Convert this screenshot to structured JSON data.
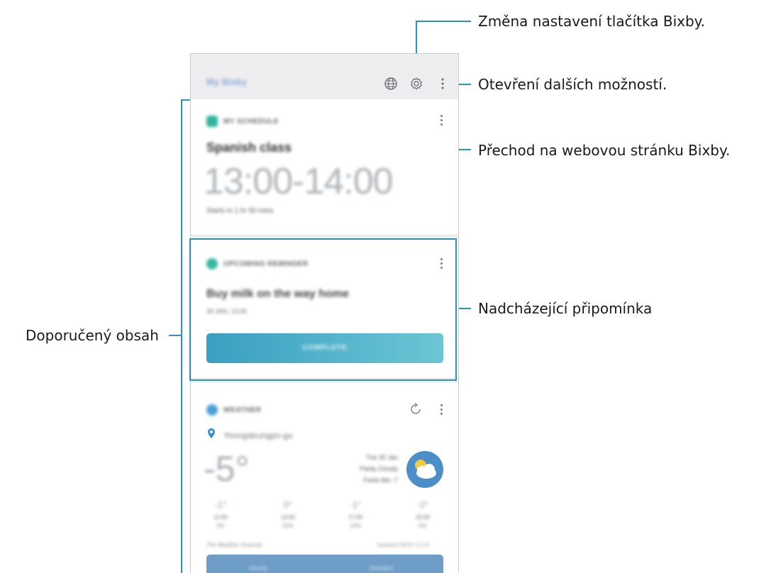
{
  "callouts": {
    "bixby_button_settings": "Změna nastavení tlačítka Bixby.",
    "more_options": "Otevření dalších možností.",
    "bixby_website": "Přechod na webovou stránku Bixby.",
    "upcoming_reminder": "Nadcházející připomínka",
    "recommended_content": "Doporučený obsah"
  },
  "header": {
    "brand": "My Bixby",
    "icons": [
      "globe-icon",
      "gear-icon",
      "more-options-icon"
    ]
  },
  "schedule_card": {
    "label": "MY SCHEDULE",
    "title": "Spanish class",
    "time": "13:00-14:00",
    "subtitle": "Starts in 1 hr 50 mins"
  },
  "reminder_card": {
    "label": "UPCOMING REMINDER",
    "title": "Buy milk on the way home",
    "date": "30 JAN, 13:30",
    "button": "COMPLETE"
  },
  "weather_card": {
    "label": "WEATHER",
    "location": "Yeongdeungpo-gu",
    "temperature": "-5°",
    "desc1": "Tue 30 Jan",
    "desc2": "Partly Cloudy",
    "desc3": "Feels like -7",
    "forecast": [
      {
        "temp": "-1°",
        "hour": "11:00",
        "precip": "0%"
      },
      {
        "temp": "0°",
        "hour": "14:00",
        "precip": "20%"
      },
      {
        "temp": "-1°",
        "hour": "17:00",
        "precip": "10%"
      },
      {
        "temp": "-2°",
        "hour": "20:00",
        "precip": "0%"
      }
    ],
    "source": "The Weather Channel",
    "updated": "Updated 30/01 11:14",
    "button_left": "Hourly",
    "button_right": "Detailed"
  },
  "colors": {
    "accent_line": "#2d93b3",
    "reminder_button": "#3a9fc1",
    "schedule_chip": "#2fb59e",
    "reminder_chip": "#35b7a3",
    "weather_chip": "#4a9fd8"
  }
}
